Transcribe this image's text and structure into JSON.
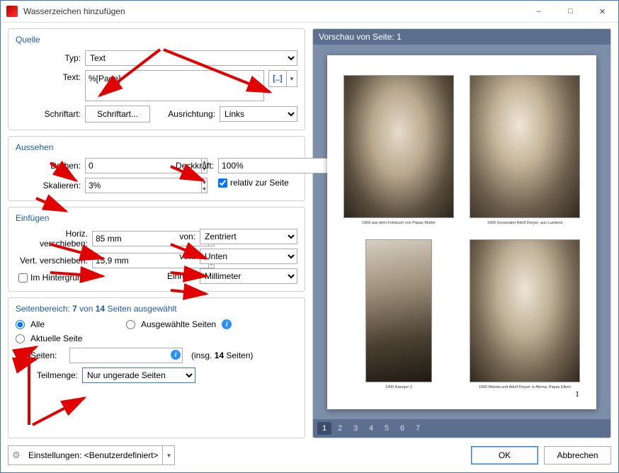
{
  "window": {
    "title": "Wasserzeichen hinzufügen"
  },
  "quelle": {
    "title": "Quelle",
    "type_label": "Typ:",
    "type_value": "Text",
    "text_label": "Text:",
    "text_value": "%[Page]",
    "font_label": "Schriftart:",
    "font_btn": "Schriftart...",
    "align_label": "Ausrichtung:",
    "align_value": "Links",
    "insert_icon": "[..]"
  },
  "aussehen": {
    "title": "Aussehen",
    "rotate_label": "Drehen:",
    "rotate_value": "0",
    "opacity_label": "Deckkraft:",
    "opacity_value": "100%",
    "scale_label": "Skalieren:",
    "scale_value": "3%",
    "relative_label": "relativ zur Seite"
  },
  "einfuegen": {
    "title": "Einfügen",
    "hshift_label": "Horiz. verschieben:",
    "hshift_value": "85 mm",
    "vshift_label": "Vert. verschieben:",
    "vshift_value": "15,9 mm",
    "hfrom_label": "von:",
    "hfrom_value": "Zentriert",
    "vfrom_label": "von:",
    "vfrom_value": "Unten",
    "bg_label": "Im Hintergrund",
    "unit_label": "Einheit:",
    "unit_value": "Millimeter"
  },
  "pages": {
    "title": "Seitenbereich: 7 von 14 Seiten ausgewählt",
    "all": "Alle",
    "selected": "Ausgewählte Seiten",
    "current": "Aktuelle Seite",
    "range": "Seiten:",
    "total": "(insg. 14 Seiten)",
    "subset_label": "Teilmenge:",
    "subset_value": "Nur ungerade Seiten"
  },
  "preview": {
    "title": "Vorschau von Seite: 1",
    "captions": [
      "1900  aus dem Fotobuch von Papas Mutter",
      "1900 Grossvater Adolf Dreyer, aus Luebeck",
      "1900 Kaerger 2",
      "1900 Wanda und Adolf Dreyer in Altona, Papas Eltern"
    ],
    "page_number": "1",
    "tabs": [
      "1",
      "2",
      "3",
      "4",
      "5",
      "6",
      "7"
    ]
  },
  "footer": {
    "settings_label": "Einstellungen:",
    "settings_value": "<Benutzerdefiniert>",
    "ok": "OK",
    "cancel": "Abbrechen"
  }
}
